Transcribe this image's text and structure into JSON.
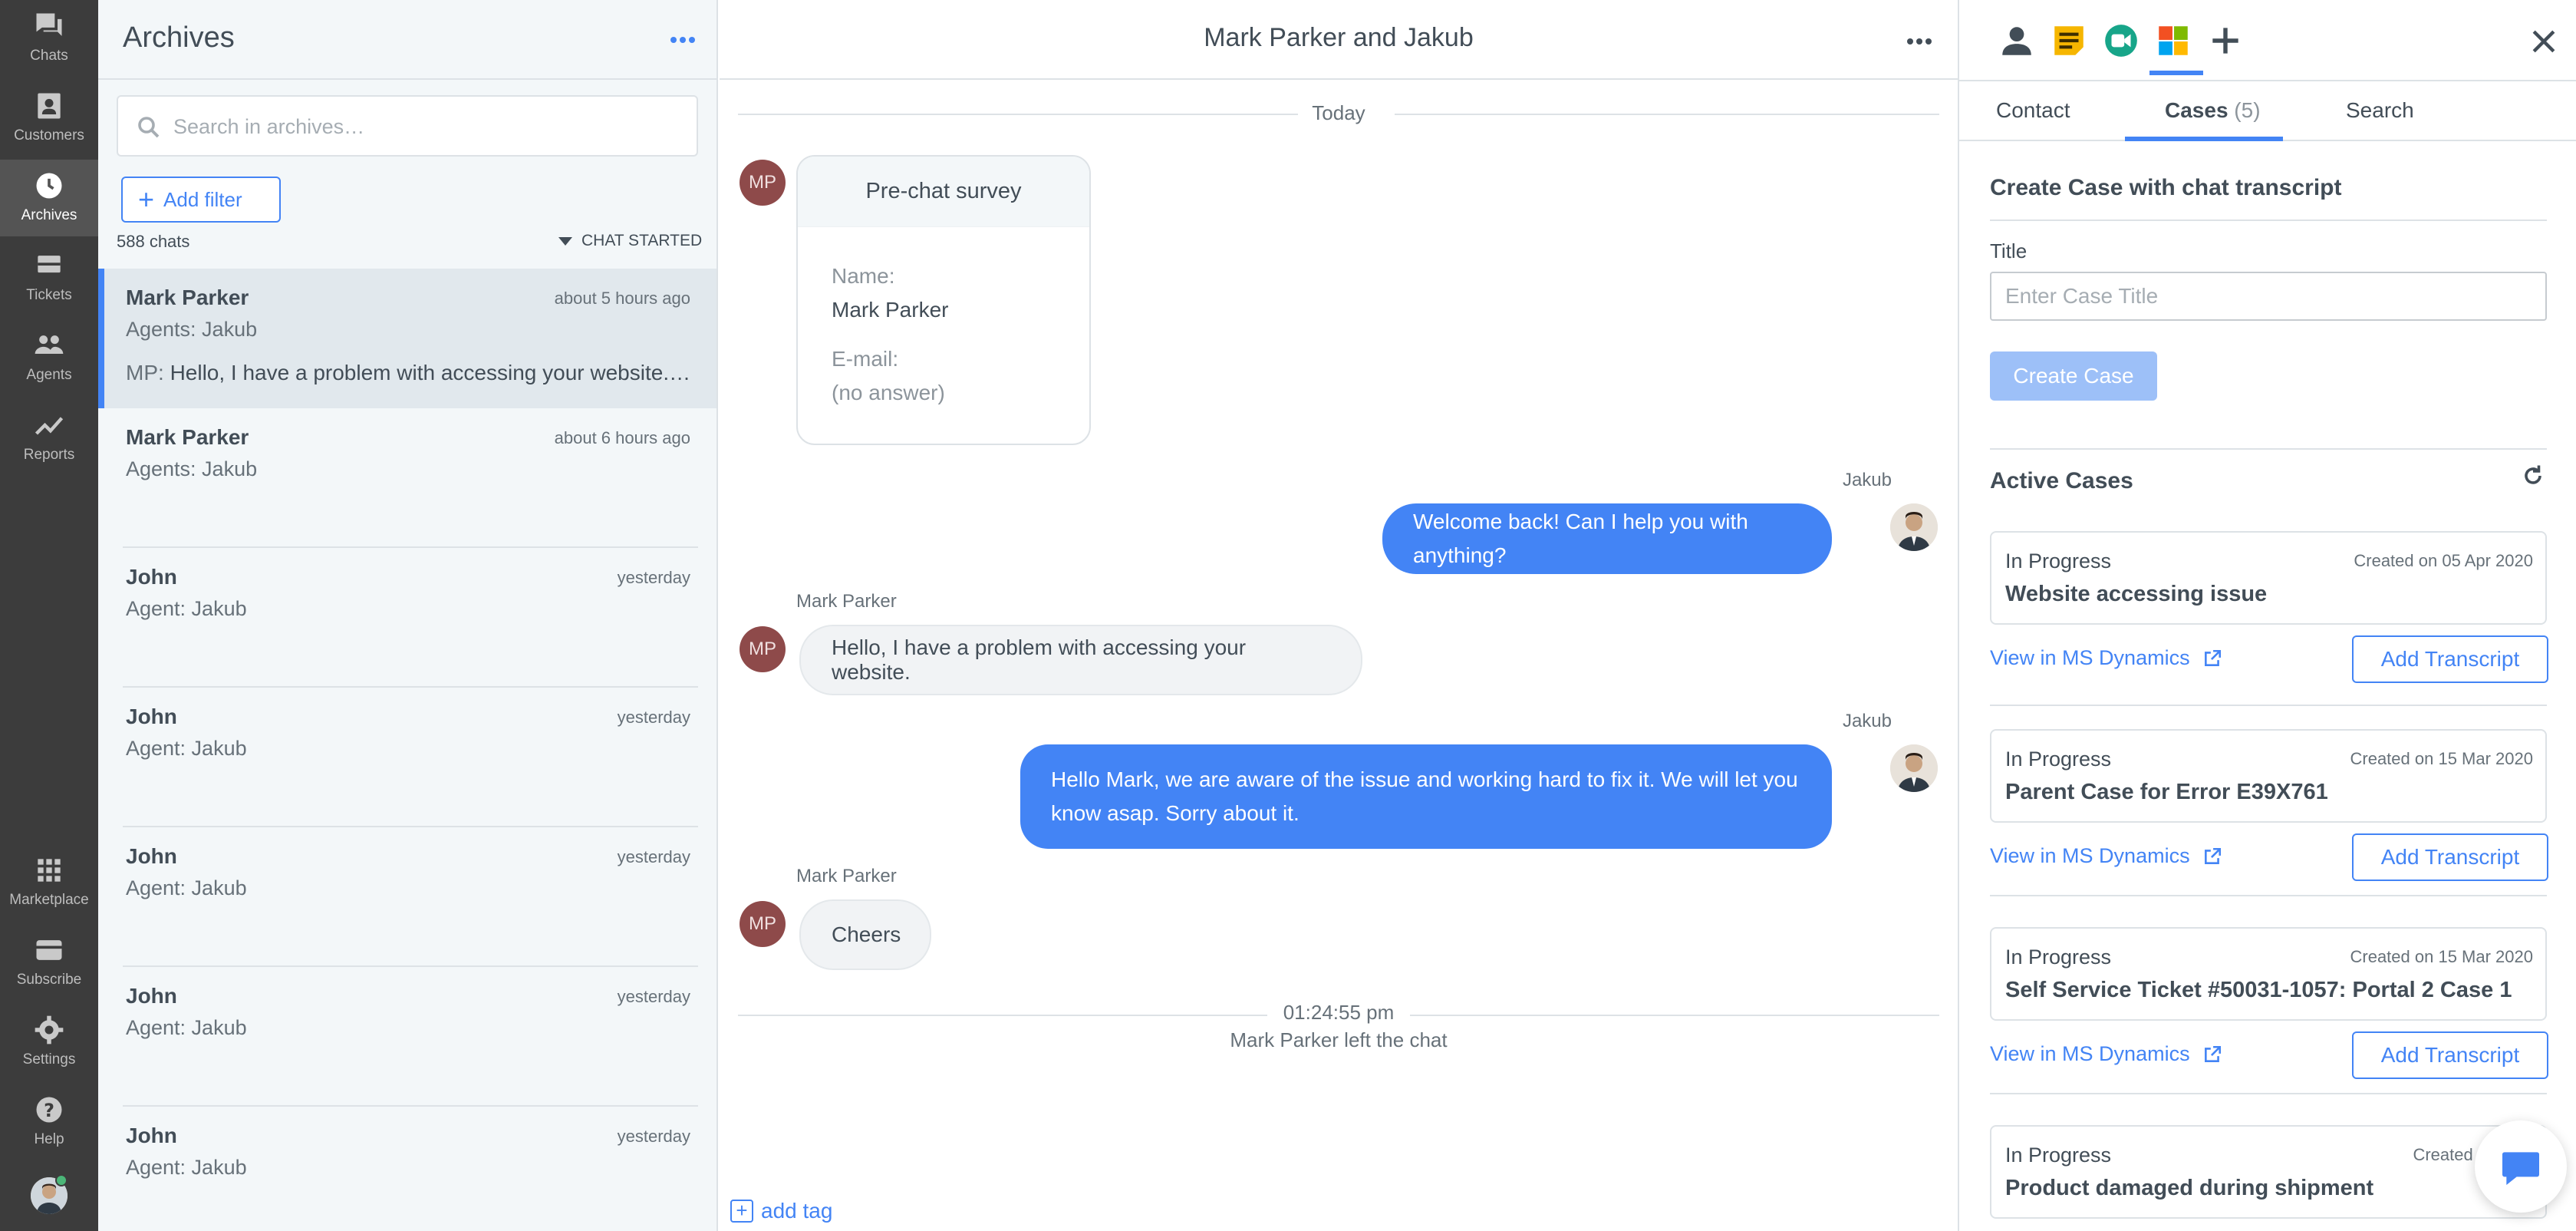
{
  "nav": {
    "items": [
      {
        "label": "Chats",
        "icon": "chats-icon"
      },
      {
        "label": "Customers",
        "icon": "customers-icon"
      },
      {
        "label": "Archives",
        "icon": "archives-icon",
        "active": true
      },
      {
        "label": "Tickets",
        "icon": "tickets-icon"
      },
      {
        "label": "Agents",
        "icon": "agents-icon"
      },
      {
        "label": "Reports",
        "icon": "reports-icon"
      },
      {
        "label": "Marketplace",
        "icon": "marketplace-icon"
      },
      {
        "label": "Subscribe",
        "icon": "subscribe-icon"
      },
      {
        "label": "Settings",
        "icon": "settings-icon"
      },
      {
        "label": "Help",
        "icon": "help-icon"
      }
    ]
  },
  "archives": {
    "title": "Archives",
    "search_placeholder": "Search in archives…",
    "add_filter": "Add filter",
    "count": "588 chats",
    "sort": "CHAT STARTED",
    "chats": [
      {
        "name": "Mark Parker",
        "time": "about 5 hours ago",
        "agent": "Agents: Jakub",
        "preview_who": "MP:",
        "preview": "Hello, I have a problem with accessing your website. …"
      },
      {
        "name": "Mark Parker",
        "time": "about 6 hours ago",
        "agent": "Agents: Jakub"
      },
      {
        "name": "John",
        "time": "yesterday",
        "agent": "Agent: Jakub"
      },
      {
        "name": "John",
        "time": "yesterday",
        "agent": "Agent: Jakub"
      },
      {
        "name": "John",
        "time": "yesterday",
        "agent": "Agent: Jakub"
      },
      {
        "name": "John",
        "time": "yesterday",
        "agent": "Agent: Jakub"
      },
      {
        "name": "John",
        "time": "yesterday",
        "agent": "Agent: Jakub"
      }
    ]
  },
  "chat": {
    "title_name1": "Mark Parker",
    "title_and": "and",
    "title_name2": "Jakub",
    "today": "Today",
    "customer_initials": "MP",
    "survey": {
      "title": "Pre-chat survey",
      "name_label": "Name:",
      "name_value": "Mark Parker",
      "email_label": "E-mail:",
      "email_value": "(no answer)"
    },
    "messages": [
      {
        "sender": "Jakub",
        "text": "Welcome back! Can I help you with anything?"
      },
      {
        "sender": "Mark Parker",
        "text": "Hello, I have a problem with accessing your website."
      },
      {
        "sender": "Jakub",
        "line1": "Hello Mark, we are aware of the issue and working hard to fix it. We will let you",
        "line2": "know asap. Sorry about it."
      },
      {
        "sender": "Mark Parker",
        "text": "Cheers"
      }
    ],
    "left_time": "01:24:55 pm",
    "left_text": "Mark Parker left the chat",
    "add_tag": "add tag"
  },
  "side": {
    "tabs": {
      "contact": "Contact",
      "cases": "Cases",
      "cases_count": "(5)",
      "search": "Search"
    },
    "create_heading": "Create Case with chat transcript",
    "title_label": "Title",
    "title_placeholder": "Enter Case Title",
    "create_button": "Create Case",
    "active_heading": "Active Cases",
    "view_link": "View in MS Dynamics",
    "add_transcript": "Add Transcript",
    "cases": [
      {
        "status": "In Progress",
        "created": "Created on 05 Apr 2020",
        "title": "Website accessing issue"
      },
      {
        "status": "In Progress",
        "created": "Created on 15 Mar 2020",
        "title": "Parent Case for Error E39X761"
      },
      {
        "status": "In Progress",
        "created": "Created on 15 Mar 2020",
        "title": "Self Service Ticket #50031-1057: Portal 2 Case 1"
      },
      {
        "status": "In Progress",
        "created": "Created on 20 J",
        "title": "Product damaged during shipment"
      }
    ]
  },
  "colors": {
    "accent": "#4384f5",
    "nav_bg": "#3c3c3c",
    "customer_avatar": "#8e4a4a"
  }
}
